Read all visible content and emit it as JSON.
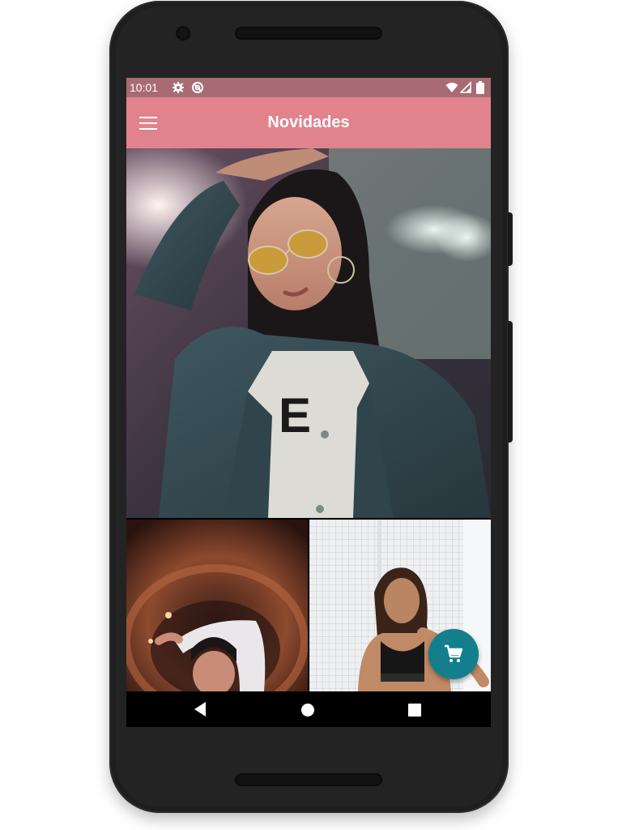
{
  "status_bar": {
    "time": "10:01",
    "icons": [
      "settings-icon",
      "sync-icon",
      "wifi-icon",
      "signal-icon",
      "battery-icon"
    ]
  },
  "app_bar": {
    "title": "Novidades",
    "menu_icon": "hamburger-menu-icon",
    "background": "#e0838c"
  },
  "feed": {
    "items": [
      {
        "name": "photo-woman-denim-jacket-sunglasses",
        "shirt_text": "E"
      },
      {
        "name": "photo-woman-tunnel"
      },
      {
        "name": "photo-woman-white-grid"
      }
    ]
  },
  "fab": {
    "icon": "cart-icon",
    "color": "#137f8c"
  },
  "navigation": {
    "buttons": [
      "back-icon",
      "home-icon",
      "recents-icon"
    ]
  }
}
